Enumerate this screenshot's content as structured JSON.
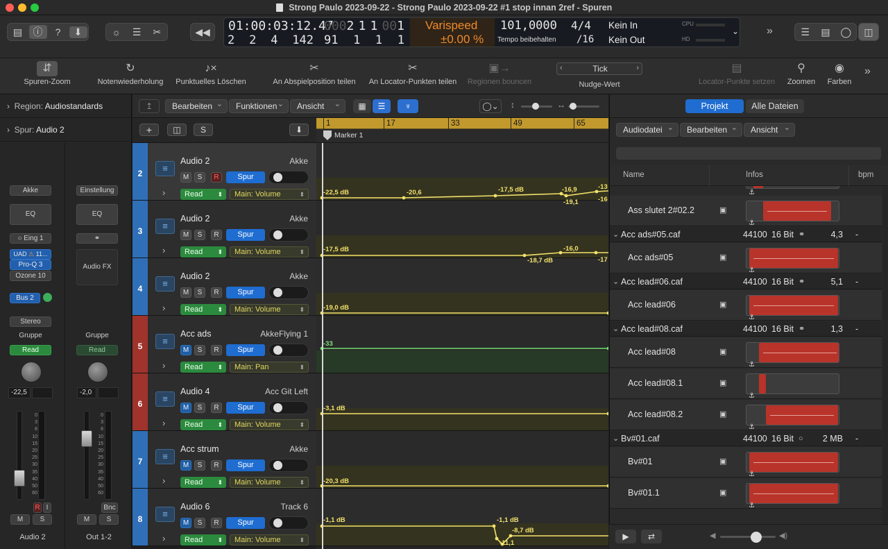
{
  "window": {
    "title": "Strong Paulo 2023-09-22 - Strong Paulo 2023-09-22 #1 stop innan 2ref - Spuren"
  },
  "lcd": {
    "time": "01:00:03:12.47",
    "bars_a": "2",
    "bars_b": "1",
    "bars_c": "1",
    "bars_d": "1",
    "bars_prefix1": "000",
    "bars_prefix2": "00",
    "pos2_a": "2",
    "pos2_b": "2",
    "pos2_c": "4",
    "pos2_d": "142",
    "pos3_a": "91",
    "pos3_b": "1",
    "pos3_c": "1",
    "pos3_d": "1",
    "varispeed_label": "Varispeed",
    "varispeed_value": "±0.00 %",
    "tempo": "101,0000",
    "tempo_sub": "Tempo beibehalten",
    "signature": "4/4",
    "division": "/16",
    "in": "Kein In",
    "out": "Kein Out",
    "cpu_label": "CPU",
    "hd_label": "HD"
  },
  "toolbar": {
    "items": [
      {
        "label": "Spuren-Zoom",
        "icon": "zoom-track-icon"
      },
      {
        "label": "Notenwiederholung",
        "icon": "note-repeat-icon"
      },
      {
        "label": "Punktuelles Löschen",
        "icon": "note-delete-icon"
      },
      {
        "label": "An Abspielposition teilen",
        "icon": "split-playhead-icon"
      },
      {
        "label": "An Locator-Punkten teilen",
        "icon": "split-locators-icon"
      },
      {
        "label": "Regionen bouncen",
        "icon": "bounce-icon"
      },
      {
        "label": "Nudge-Wert",
        "icon": "nudge-icon"
      },
      {
        "label": "Locator-Punkte setzen",
        "icon": "set-locators-icon"
      },
      {
        "label": "Zoomen",
        "icon": "zoom-icon"
      },
      {
        "label": "Farben",
        "icon": "palette-icon"
      }
    ],
    "nudge_value": "Tick"
  },
  "inspector": {
    "region_label": "Region:",
    "region_value": "Audiostandards",
    "track_label": "Spur:",
    "track_value": "Audio 2",
    "strip1": {
      "setting": "Akke",
      "eq": "EQ",
      "input": "Eing 1",
      "plugins": [
        "UAD",
        "11...",
        "Pro-Q 3",
        "Ozone 10"
      ],
      "bus": "Bus 2",
      "stereo": "Stereo",
      "group": "Gruppe",
      "automation": "Read",
      "volume": "-22,5",
      "name": "Audio 2"
    },
    "strip2": {
      "setting": "Einstellung",
      "eq": "EQ",
      "audio_fx": "Audio FX",
      "group": "Gruppe",
      "automation": "Read",
      "volume": "-2,0",
      "bnc": "Bnc",
      "name": "Out 1-2"
    },
    "fader_scale": [
      "0",
      "3",
      "6",
      "10",
      "15",
      "20",
      "25",
      "30",
      "35",
      "40",
      "50",
      "60"
    ],
    "mute": "M",
    "solo": "S",
    "rec": "R",
    "input_mon": "I"
  },
  "tracklist_header": {
    "menus": [
      "Bearbeiten",
      "Funktionen",
      "Ansicht"
    ],
    "add": "+",
    "solo": "S"
  },
  "tracks": [
    {
      "num": "2",
      "name": "Audio 2",
      "patch": "Akke",
      "mode": "Read",
      "param": "Main: Volume",
      "color": "#2f6fb7",
      "rec_red": true
    },
    {
      "num": "3",
      "name": "Audio 2",
      "patch": "Akke",
      "mode": "Read",
      "param": "Main: Volume",
      "color": "#2f6fb7",
      "rec_red": false
    },
    {
      "num": "4",
      "name": "Audio 2",
      "patch": "Akke",
      "mode": "Read",
      "param": "Main: Volume",
      "color": "#2f6fb7",
      "rec_red": false
    },
    {
      "num": "5",
      "name": "Acc ads",
      "patch": "AkkeFlying 1",
      "mode": "Read",
      "param": "Main: Pan",
      "color": "#a0332b",
      "rec_red": false
    },
    {
      "num": "6",
      "name": "Audio 4",
      "patch": "Acc Git Left",
      "mode": "Read",
      "param": "Main: Volume",
      "color": "#a0332b",
      "rec_red": false
    },
    {
      "num": "7",
      "name": "Acc strum",
      "patch": "Akke",
      "mode": "Read",
      "param": "Main: Volume",
      "color": "#2f6fb7",
      "rec_red": false
    },
    {
      "num": "8",
      "name": "Audio 6",
      "patch": "Track 6",
      "mode": "Read",
      "param": "Main: Volume",
      "color": "#2f6fb7",
      "rec_red": false
    }
  ],
  "buttons": {
    "m": "M",
    "s": "S",
    "r": "R",
    "spur": "Spur"
  },
  "ruler": {
    "ticks": [
      "1",
      "17",
      "33",
      "49",
      "65"
    ],
    "marker": "Marker 1"
  },
  "automation_labels": {
    "t2": [
      "-22,5 dB",
      "-20,6",
      "-17,5 dB",
      "-16,9",
      "-19,1",
      "-13",
      "-16"
    ],
    "t3": [
      "-17,5 dB",
      "-18,7 dB",
      "-16,0",
      "-17"
    ],
    "t4": [
      "-19,0 dB"
    ],
    "t5": [
      "-33"
    ],
    "t6": [
      "-3,1 dB"
    ],
    "t7": [
      "-20,3 dB"
    ],
    "t8": [
      "-1,1 dB",
      "-1,1 dB",
      "-8,7 dB",
      "-11,1"
    ]
  },
  "browser": {
    "tabs": [
      "Projekt",
      "Alle Dateien"
    ],
    "menus": [
      "Audiodatei",
      "Bearbeiten",
      "Ansicht"
    ],
    "columns": [
      "Name",
      "Infos",
      "bpm"
    ],
    "rows": [
      {
        "type": "region",
        "name": "Ass slutet 2#02.2"
      },
      {
        "type": "group",
        "name": "Acc ads#05.caf",
        "rate": "44100",
        "bits": "16 Bit",
        "size": "4,3 MB",
        "bpm": "-"
      },
      {
        "type": "region",
        "name": "Acc ads#05"
      },
      {
        "type": "group",
        "name": "Acc lead#06.caf",
        "rate": "44100",
        "bits": "16 Bit",
        "size": "5,1 MB",
        "bpm": "-"
      },
      {
        "type": "region",
        "name": "Acc lead#06"
      },
      {
        "type": "group",
        "name": "Acc lead#08.caf",
        "rate": "44100",
        "bits": "16 Bit",
        "size": "1,3 MB",
        "bpm": "-"
      },
      {
        "type": "region",
        "name": "Acc lead#08"
      },
      {
        "type": "region",
        "name": "Acc lead#08.1"
      },
      {
        "type": "region",
        "name": "Acc lead#08.2"
      },
      {
        "type": "group",
        "name": "Bv#01.caf",
        "rate": "44100",
        "bits": "16 Bit",
        "size": "2 MB",
        "bpm": "-"
      },
      {
        "type": "region",
        "name": "Bv#01"
      },
      {
        "type": "region",
        "name": "Bv#01.1"
      }
    ]
  }
}
